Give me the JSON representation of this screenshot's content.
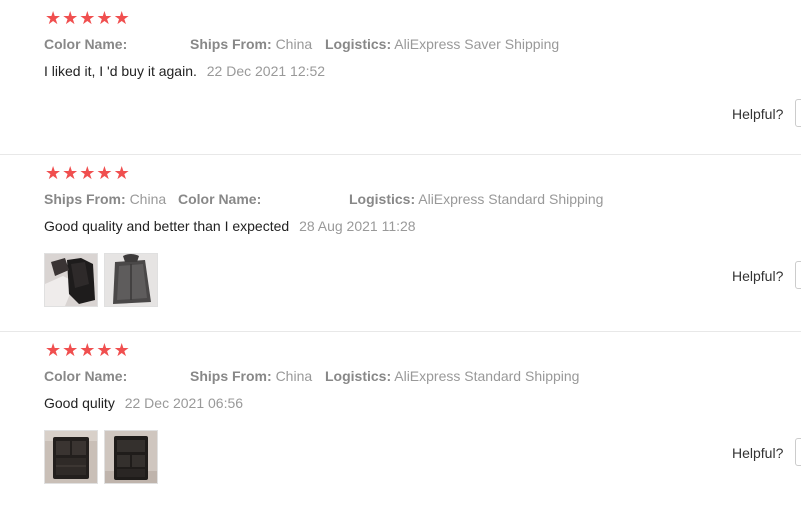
{
  "labels": {
    "color_name": "Color Name:",
    "ships_from": "Ships From:",
    "logistics": "Logistics:",
    "helpful": "Helpful?"
  },
  "reviews": [
    {
      "rating": 5,
      "color_name_value": "",
      "ships_from_value": "China",
      "logistics_value": "AliExpress Saver Shipping",
      "text": "I liked it, I 'd buy it again.",
      "date": "22 Dec 2021 12:52",
      "photo_icons": []
    },
    {
      "rating": 5,
      "color_name_value": "",
      "ships_from_value": "China",
      "logistics_value": "AliExpress Standard Shipping",
      "text": "Good quality and better than I expected",
      "date": "28 Aug 2021 11:28",
      "photo_icons": [
        "dark-bag-photo",
        "grey-bag-photo"
      ]
    },
    {
      "rating": 5,
      "color_name_value": "",
      "ships_from_value": "China",
      "logistics_value": "AliExpress Standard Shipping",
      "text": "Good qulity",
      "date": "22 Dec 2021 06:56",
      "photo_icons": [
        "organizer-photo",
        "organizer-photo"
      ]
    }
  ],
  "colors": {
    "star": "#f04f4f",
    "meta_text": "#999999",
    "body_text": "#222222",
    "divider": "#e8e8e8"
  }
}
